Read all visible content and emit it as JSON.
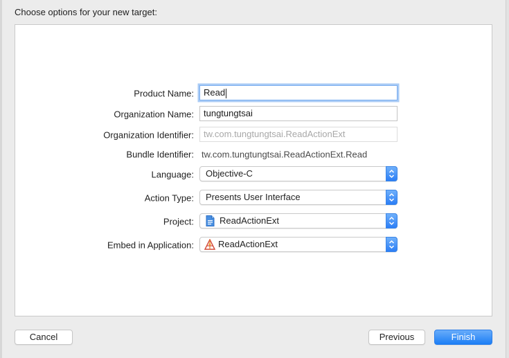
{
  "dialog": {
    "title": "Choose options for your new target:"
  },
  "form": {
    "product_name": {
      "label": "Product Name:",
      "value": "Read"
    },
    "organization_name": {
      "label": "Organization Name:",
      "value": "tungtungtsai"
    },
    "organization_identifier": {
      "label": "Organization Identifier:",
      "value": "tw.com.tungtungtsai.ReadActionExt"
    },
    "bundle_identifier": {
      "label": "Bundle Identifier:",
      "value": "tw.com.tungtungtsai.ReadActionExt.Read"
    },
    "language": {
      "label": "Language:",
      "value": "Objective-C"
    },
    "action_type": {
      "label": "Action Type:",
      "value": "Presents User Interface"
    },
    "project": {
      "label": "Project:",
      "value": "ReadActionExt",
      "icon": "project-file-icon"
    },
    "embed_in_application": {
      "label": "Embed in Application:",
      "value": "ReadActionExt",
      "icon": "app-target-icon"
    }
  },
  "buttons": {
    "cancel": "Cancel",
    "previous": "Previous",
    "finish": "Finish"
  },
  "colors": {
    "accent": "#1c7ef5",
    "focus_ring": "#a9cbf5"
  }
}
